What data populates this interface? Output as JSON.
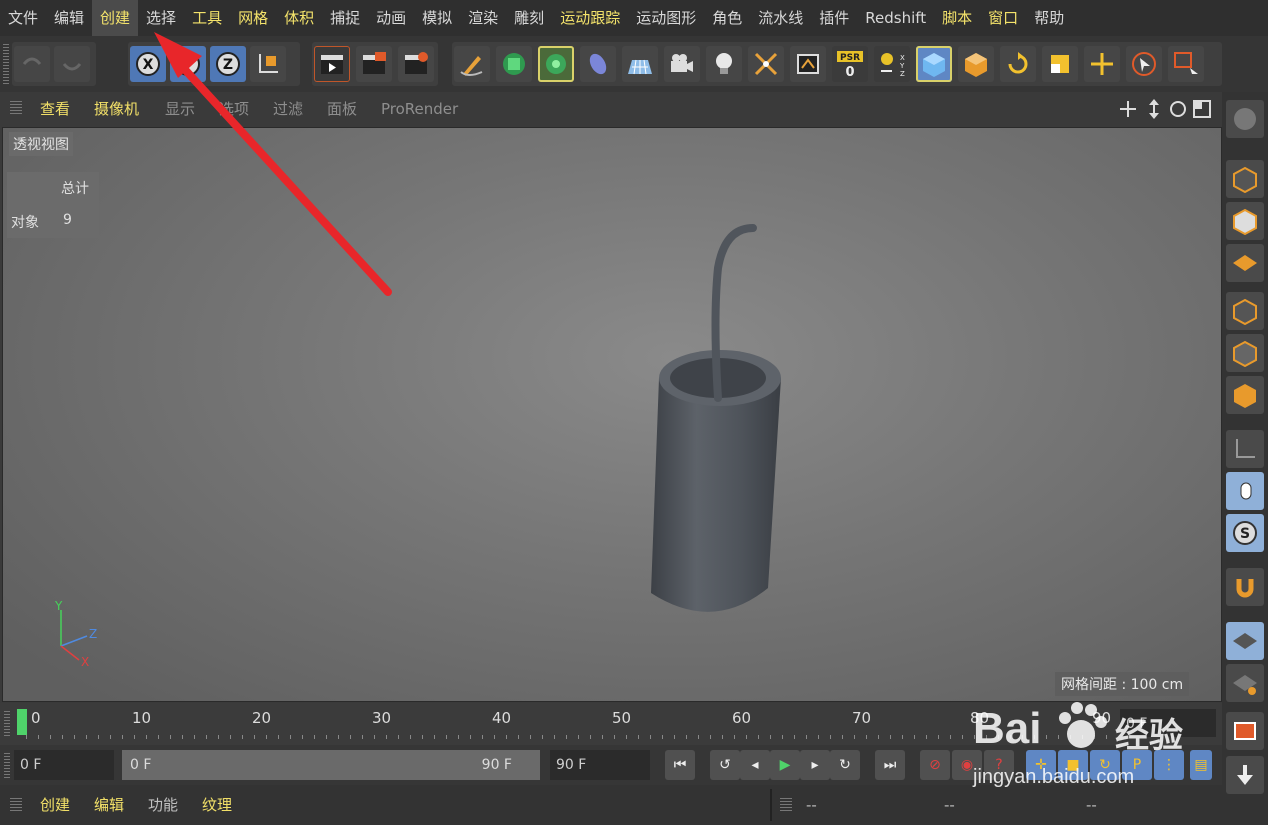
{
  "menu": [
    "文件",
    "编辑",
    "创建",
    "选择",
    "工具",
    "网格",
    "体积",
    "捕捉",
    "动画",
    "模拟",
    "渲染",
    "雕刻",
    "运动跟踪",
    "运动图形",
    "角色",
    "流水线",
    "插件",
    "Redshift",
    "脚本",
    "窗口",
    "帮助"
  ],
  "toolbar": {
    "xyz_x": "X",
    "xyz_z": "Z",
    "psr_label": "PSR",
    "psr_value": "0",
    "coord_label": "X Y Z"
  },
  "viewport_menu": [
    "查看",
    "摄像机",
    "显示",
    "选项",
    "过滤",
    "面板",
    "ProRender"
  ],
  "viewport": {
    "view_name": "透视视图",
    "stats_header": "总计",
    "stats_label": "对象",
    "stats_value": "9",
    "grid_spacing": "网格间距 : 100 cm",
    "axis_y": "Y",
    "axis_z": "Z",
    "axis_x": "X"
  },
  "timeline": {
    "labels": [
      "0",
      "10",
      "20",
      "30",
      "40",
      "50",
      "60",
      "70",
      "80",
      "90"
    ],
    "end_field": "0 F"
  },
  "transport": {
    "current_frame": "0 F",
    "range_start": "0 F",
    "range_end": "90 F",
    "max_frame": "90 F"
  },
  "bottom_left": [
    "创建",
    "编辑",
    "功能",
    "纹理"
  ],
  "bottom_right": [
    "--",
    "--",
    "--"
  ],
  "watermark": {
    "brand": "Bai",
    "brand2": "经验",
    "url": "jingyan.baidu.com"
  },
  "colors": {
    "accent_yellow": "#f4e36b",
    "arrow_red": "#e8262a",
    "selection_blue": "#5f87c4"
  }
}
